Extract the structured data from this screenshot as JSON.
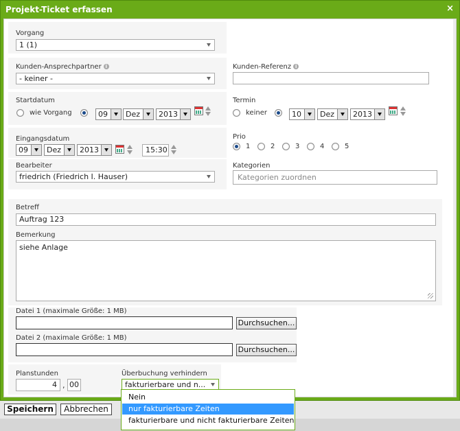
{
  "dialog": {
    "title": "Projekt-Ticket erfassen",
    "close": "×"
  },
  "vorgang": {
    "label": "Vorgang",
    "value": "1 (1)"
  },
  "kunden_ansprechpartner": {
    "label": "Kunden-Ansprechpartner",
    "value": "- keiner -"
  },
  "kunden_referenz": {
    "label": "Kunden-Referenz",
    "value": ""
  },
  "startdatum": {
    "label": "Startdatum",
    "option_wie_vorgang": "wie Vorgang",
    "day": "09",
    "month": "Dez",
    "year": "2013"
  },
  "termin": {
    "label": "Termin",
    "option_keiner": "keiner",
    "day": "10",
    "month": "Dez",
    "year": "2013"
  },
  "eingangsdatum": {
    "label": "Eingangsdatum",
    "day": "09",
    "month": "Dez",
    "year": "2013",
    "time": "15:30"
  },
  "prio": {
    "label": "Prio",
    "options": [
      "1",
      "2",
      "3",
      "4",
      "5"
    ],
    "selected": "1"
  },
  "bearbeiter": {
    "label": "Bearbeiter",
    "value": "friedrich (Friedrich I. Hauser)"
  },
  "kategorien": {
    "label": "Kategorien",
    "placeholder": "Kategorien zuordnen"
  },
  "betreff": {
    "label": "Betreff",
    "value": "Auftrag 123"
  },
  "bemerkung": {
    "label": "Bemerkung",
    "value": "siehe Anlage"
  },
  "datei1": {
    "label": "Datei 1 (maximale Größe: 1 MB)",
    "button": "Durchsuchen..."
  },
  "datei2": {
    "label": "Datei 2 (maximale Größe: 1 MB)",
    "button": "Durchsuchen..."
  },
  "planstunden": {
    "label": "Planstunden",
    "hours": "4",
    "separator": ",",
    "minutes": "00"
  },
  "ueberbuchung": {
    "label": "Überbuchung verhindern",
    "value": "fakturierbare und n...",
    "options": [
      "Nein",
      "nur fakturierbare Zeiten",
      "fakturierbare und nicht fakturierbare Zeiten"
    ],
    "highlighted": "nur fakturierbare Zeiten"
  },
  "footer": {
    "save": "Speichern",
    "cancel": "Abbrechen"
  },
  "colors": {
    "titlebar": "#6aab18",
    "highlight": "#3399ff",
    "panel": "#f5f5f5"
  }
}
